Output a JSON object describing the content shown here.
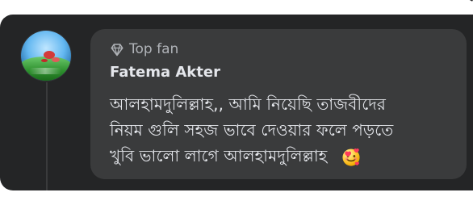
{
  "comment": {
    "badge_label": "Top fan",
    "author_name": "Fatema Akter",
    "text_lines": [
      "আলহামদুলিল্লাহ,,  আমি নিয়েছি তাজবীদের",
      "নিয়ম গুলি সহজ ভাবে দেওয়ার ফলে পড়তে",
      "খুবি ভালো লাগে আলহামদুলিল্লাহ"
    ],
    "icons": {
      "badge_icon": "gem-icon",
      "reaction_emoji": "smiling-face-with-hearts-emoji"
    }
  },
  "theme": {
    "background": "#242526",
    "bubble": "#3a3b3c",
    "primary_text": "#e4e6eb",
    "secondary_text": "#b0b3b8"
  }
}
